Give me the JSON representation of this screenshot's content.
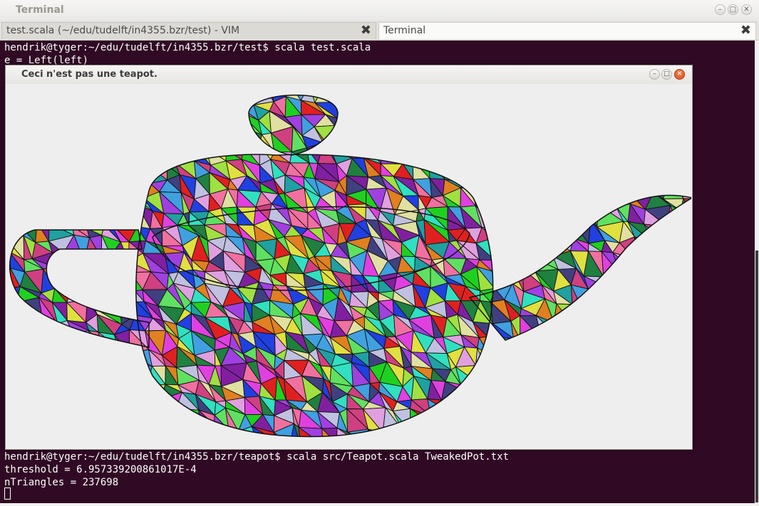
{
  "terminal_window": {
    "title": "Terminal",
    "tabs": [
      {
        "label": "test.scala (~/edu/tudelft/in4355.bzr/test) - VIM"
      },
      {
        "label": "Terminal"
      }
    ],
    "lines": [
      "hendrik@tyger:~/edu/tudelft/in4355.bzr/test$ scala test.scala",
      "e = Left(left)",
      "hendrik@tyger:~/edu/tudelft/in4355.bzr/teapot$ scala src/Teapot.scala TweakedPot.txt",
      "threshold = 6.957339200861017E-4",
      "nTriangles = 237698"
    ],
    "colors": {
      "terminal_bg": "#300a24",
      "terminal_fg": "#ffffff",
      "close_button": "#df4b16"
    }
  },
  "teapot_window": {
    "title": "Ceci n'est pas une teapot.",
    "palette": [
      "#e040e0",
      "#20d020",
      "#2040e0",
      "#e02020",
      "#30e0c0",
      "#e0e040",
      "#a040e0",
      "#40a0e0",
      "#e08020",
      "#f070a0",
      "#60e060",
      "#c0c0e0",
      "#208040",
      "#8020a0",
      "#e0a0e0",
      "#a0e040",
      "#20a0a0",
      "#e0e0a0",
      "#404080",
      "#d04080"
    ]
  }
}
